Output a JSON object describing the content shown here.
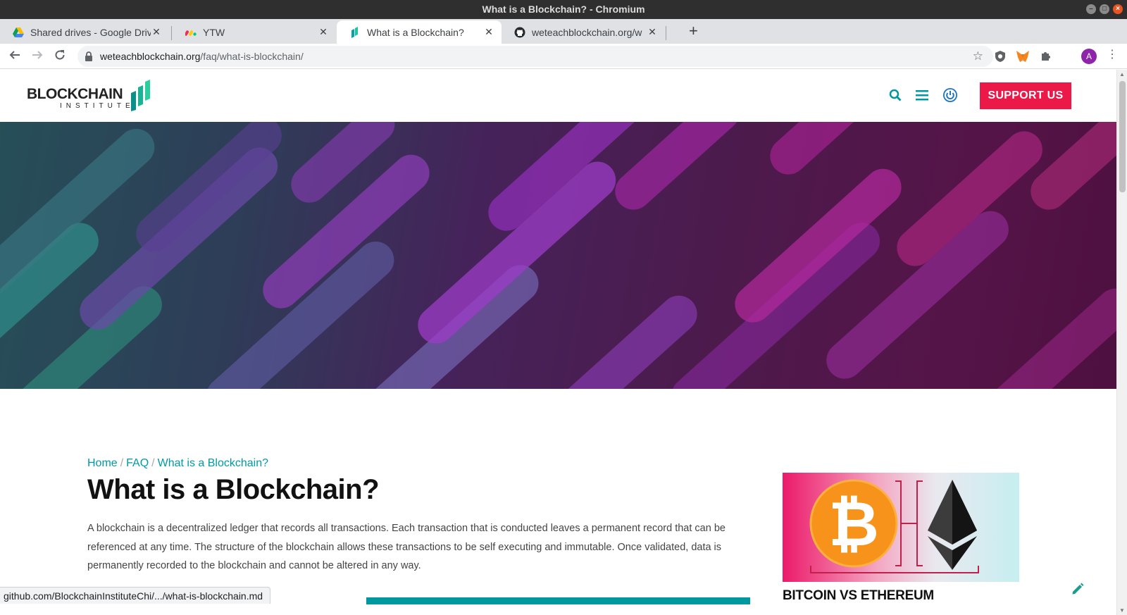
{
  "window": {
    "title": "What is a Blockchain? - Chromium"
  },
  "tabs": [
    {
      "title": "Shared drives - Google Drive",
      "icon": "google-drive-icon",
      "active": false
    },
    {
      "title": "YTW",
      "icon": "monday-icon",
      "active": false
    },
    {
      "title": "What is a Blockchain?",
      "icon": "blockchain-institute-icon",
      "active": true
    },
    {
      "title": "weteachblockchain.org/w",
      "icon": "github-icon",
      "active": false
    }
  ],
  "address_bar": {
    "domain": "weteachblockchain.org",
    "path": "/faq/what-is-blockchain/"
  },
  "profile": {
    "initial": "A"
  },
  "site": {
    "logo_text": "BLOCKCHAIN",
    "logo_sub": "INSTITUTE",
    "support_label": "SUPPORT US",
    "accent": "#009aa6",
    "brand_red": "#ec1848"
  },
  "breadcrumb": {
    "home": "Home",
    "faq": "FAQ",
    "current": "What is a Blockchain?",
    "separator": "/"
  },
  "article": {
    "title": "What is a Blockchain?",
    "intro": "A blockchain is a decentralized ledger that records all transactions. Each transaction that is conducted leaves a permanent record that can be referenced at any time. The structure of the blockchain allows these transactions to be self executing and immutable. Once validated, data is permanently recorded to the blockchain and cannot be altered in any way."
  },
  "sidebar": {
    "card_title": "BITCOIN VS ETHEREUM"
  },
  "status_url": "github.com/BlockchainInstituteChi/.../what-is-blockchain.md"
}
